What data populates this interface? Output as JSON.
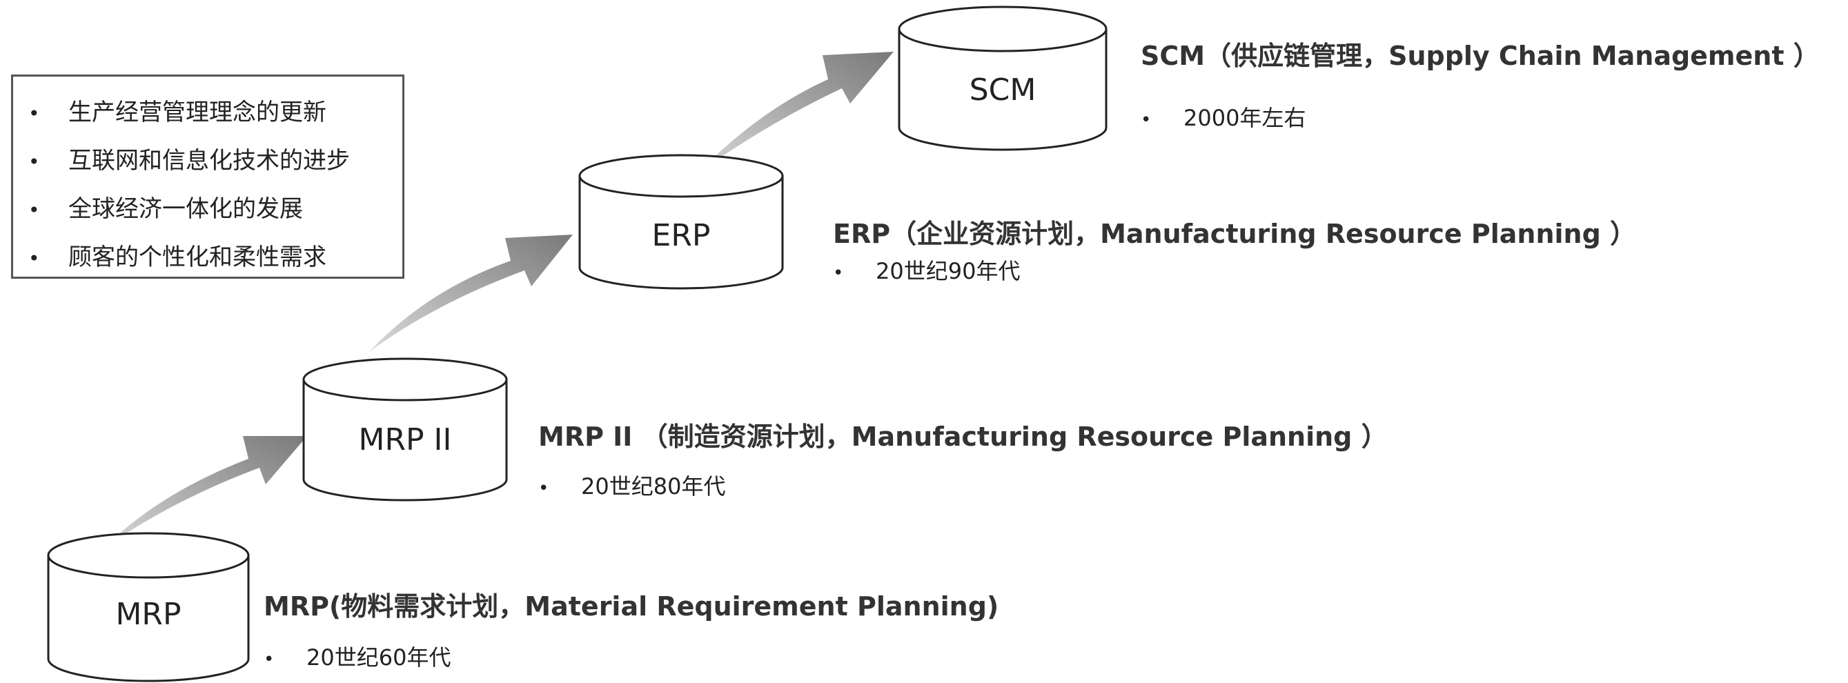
{
  "drivers": [
    "生产经营管理理念的更新",
    "互联网和信息化技术的进步",
    "全球经济一体化的发展",
    "顾客的个性化和柔性需求"
  ],
  "bullet": "•",
  "stages": [
    {
      "id": "mrp",
      "label": "MRP",
      "title": "MRP(物料需求计划，Material Requirement Planning)",
      "period": "20世纪60年代"
    },
    {
      "id": "mrp2",
      "label": "MRP II",
      "title": "MRP II （制造资源计划，Manufacturing Resource Planning ）",
      "period": "20世纪80年代"
    },
    {
      "id": "erp",
      "label": "ERP",
      "title": "ERP（企业资源计划，Manufacturing Resource Planning ）",
      "period": "20世纪90年代"
    },
    {
      "id": "scm",
      "label": "SCM",
      "title": "SCM（供应链管理，Supply Chain Management ）",
      "period": "2000年左右"
    }
  ],
  "colors": {
    "arrow": "#8a8a8a",
    "cylinder_stroke": "#222222",
    "box_border": "#555555"
  }
}
